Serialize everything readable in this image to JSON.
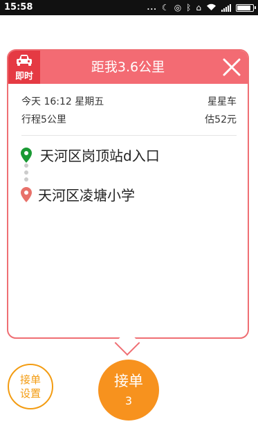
{
  "status_bar": {
    "time": "15:58",
    "dots": "...",
    "icons": [
      "moon-icon",
      "ring-icon",
      "bluetooth-icon",
      "vibrate-icon",
      "wifi-icon",
      "signal-icon",
      "battery-icon"
    ]
  },
  "order_card": {
    "badge_label": "即时",
    "title": "距我3.6公里",
    "date_time": "今天 16:12 星期五",
    "car_type": "星星车",
    "trip_distance": "行程5公里",
    "estimated_price": "估52元",
    "origin": "天河区岗顶站d入口",
    "destination": "天河区凌塘小学",
    "colors": {
      "header": "#f36b73",
      "badge": "#e53a43",
      "origin_pin": "#1a9a34",
      "destination_pin": "#e8716a"
    }
  },
  "actions": {
    "settings_line1": "接单",
    "settings_line2": "设置",
    "accept_label": "接单",
    "accept_count": "3",
    "accent_color": "#f7921e"
  }
}
